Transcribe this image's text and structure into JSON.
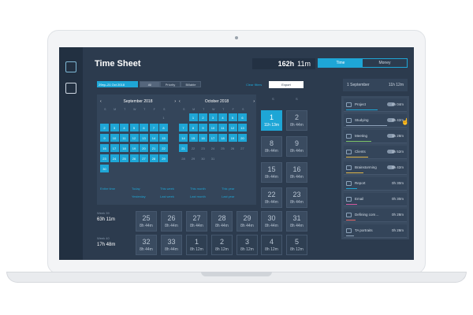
{
  "header": {
    "title": "Time Sheet",
    "total_prefix": "162h",
    "total_suffix": "11m",
    "tabs": [
      "Time",
      "Money"
    ]
  },
  "toolbar": {
    "range": "29ep–21 Oct 2018",
    "filters": [
      "All",
      "Priority",
      "Billable"
    ],
    "clear": "Clear filters",
    "export": "Export"
  },
  "calendar": {
    "sep": {
      "label": "September 2018",
      "weekdays": [
        "S",
        "M",
        "T",
        "W",
        "T",
        "F",
        "S"
      ]
    },
    "oct": {
      "label": "October 2018",
      "weekdays": [
        "S",
        "M",
        "T",
        "W",
        "T",
        "F",
        "S"
      ]
    }
  },
  "quick": [
    "Today",
    "This week",
    "This month",
    "This year",
    "Yesterday",
    "Last week",
    "Last month",
    "Last year"
  ],
  "quick_extra": "Entire time",
  "days": [
    {
      "n": "1",
      "h": "11h 13m"
    },
    {
      "n": "2",
      "h": "8h 44m"
    },
    {
      "n": "8",
      "h": "8h 44m"
    },
    {
      "n": "9",
      "h": "8h 44m"
    },
    {
      "n": "15",
      "h": "8h 44m"
    },
    {
      "n": "16",
      "h": "8h 44m"
    },
    {
      "n": "22",
      "h": "8h 44m"
    },
    {
      "n": "23",
      "h": "8h 44m"
    },
    {
      "n": "25",
      "h": "8h 44m"
    },
    {
      "n": "26",
      "h": "8h 44m"
    },
    {
      "n": "27",
      "h": "8h 44m"
    },
    {
      "n": "28",
      "h": "8h 44m"
    },
    {
      "n": "29",
      "h": "8h 44m"
    },
    {
      "n": "30",
      "h": "8h 44m"
    },
    {
      "n": "31",
      "h": "8h 44m"
    },
    {
      "n": "32",
      "h": "8h 44m"
    },
    {
      "n": "33",
      "h": "8h 44m"
    },
    {
      "n": "1",
      "h": "8h 12m"
    },
    {
      "n": "2",
      "h": "8h 12m"
    },
    {
      "n": "3",
      "h": "8h 12m"
    },
    {
      "n": "4",
      "h": "8h 12m"
    },
    {
      "n": "5",
      "h": "8h 12m"
    }
  ],
  "weeks": [
    {
      "label": "Week 39",
      "value": "63h 11m"
    },
    {
      "label": "Week 40",
      "value": "17h 48m"
    }
  ],
  "right": {
    "date": "1 September",
    "time": "11h 12m",
    "projects": [
      {
        "name": "Project",
        "time": "4h 04m"
      },
      {
        "name": "Studying",
        "time": "2h 42m"
      },
      {
        "name": "Meeting",
        "time": "1h 28m"
      },
      {
        "name": "Clients",
        "time": "1h 52m"
      },
      {
        "name": "Brainstorming",
        "time": "0h 42m"
      },
      {
        "name": "Report",
        "time": "0h 30m"
      },
      {
        "name": "Email",
        "time": "0h 30m"
      },
      {
        "name": "Defining com…",
        "time": "0h 28m"
      },
      {
        "name": "TA portraits",
        "time": "0h 28m"
      }
    ]
  }
}
